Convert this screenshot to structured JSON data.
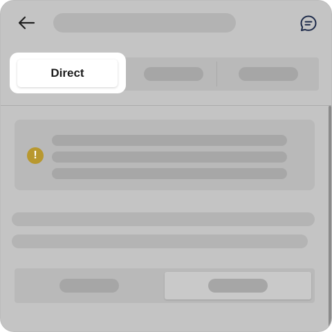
{
  "header": {
    "back_icon": "arrow-left-icon",
    "title_placeholder": "",
    "chat_icon": "chat-bubble-icon"
  },
  "tabs": [
    {
      "label": "Direct",
      "selected": true
    },
    {
      "label": "",
      "selected": false
    },
    {
      "label": "",
      "selected": false
    }
  ],
  "notice": {
    "icon": "warning-icon",
    "icon_color": "#b8982f",
    "lines": [
      "",
      "",
      ""
    ]
  },
  "toggle": {
    "options": [
      "",
      ""
    ],
    "selected_index": 1
  },
  "colors": {
    "overlay": "#c4c4c4",
    "highlight": "#ffffff",
    "warning": "#b8982f"
  }
}
